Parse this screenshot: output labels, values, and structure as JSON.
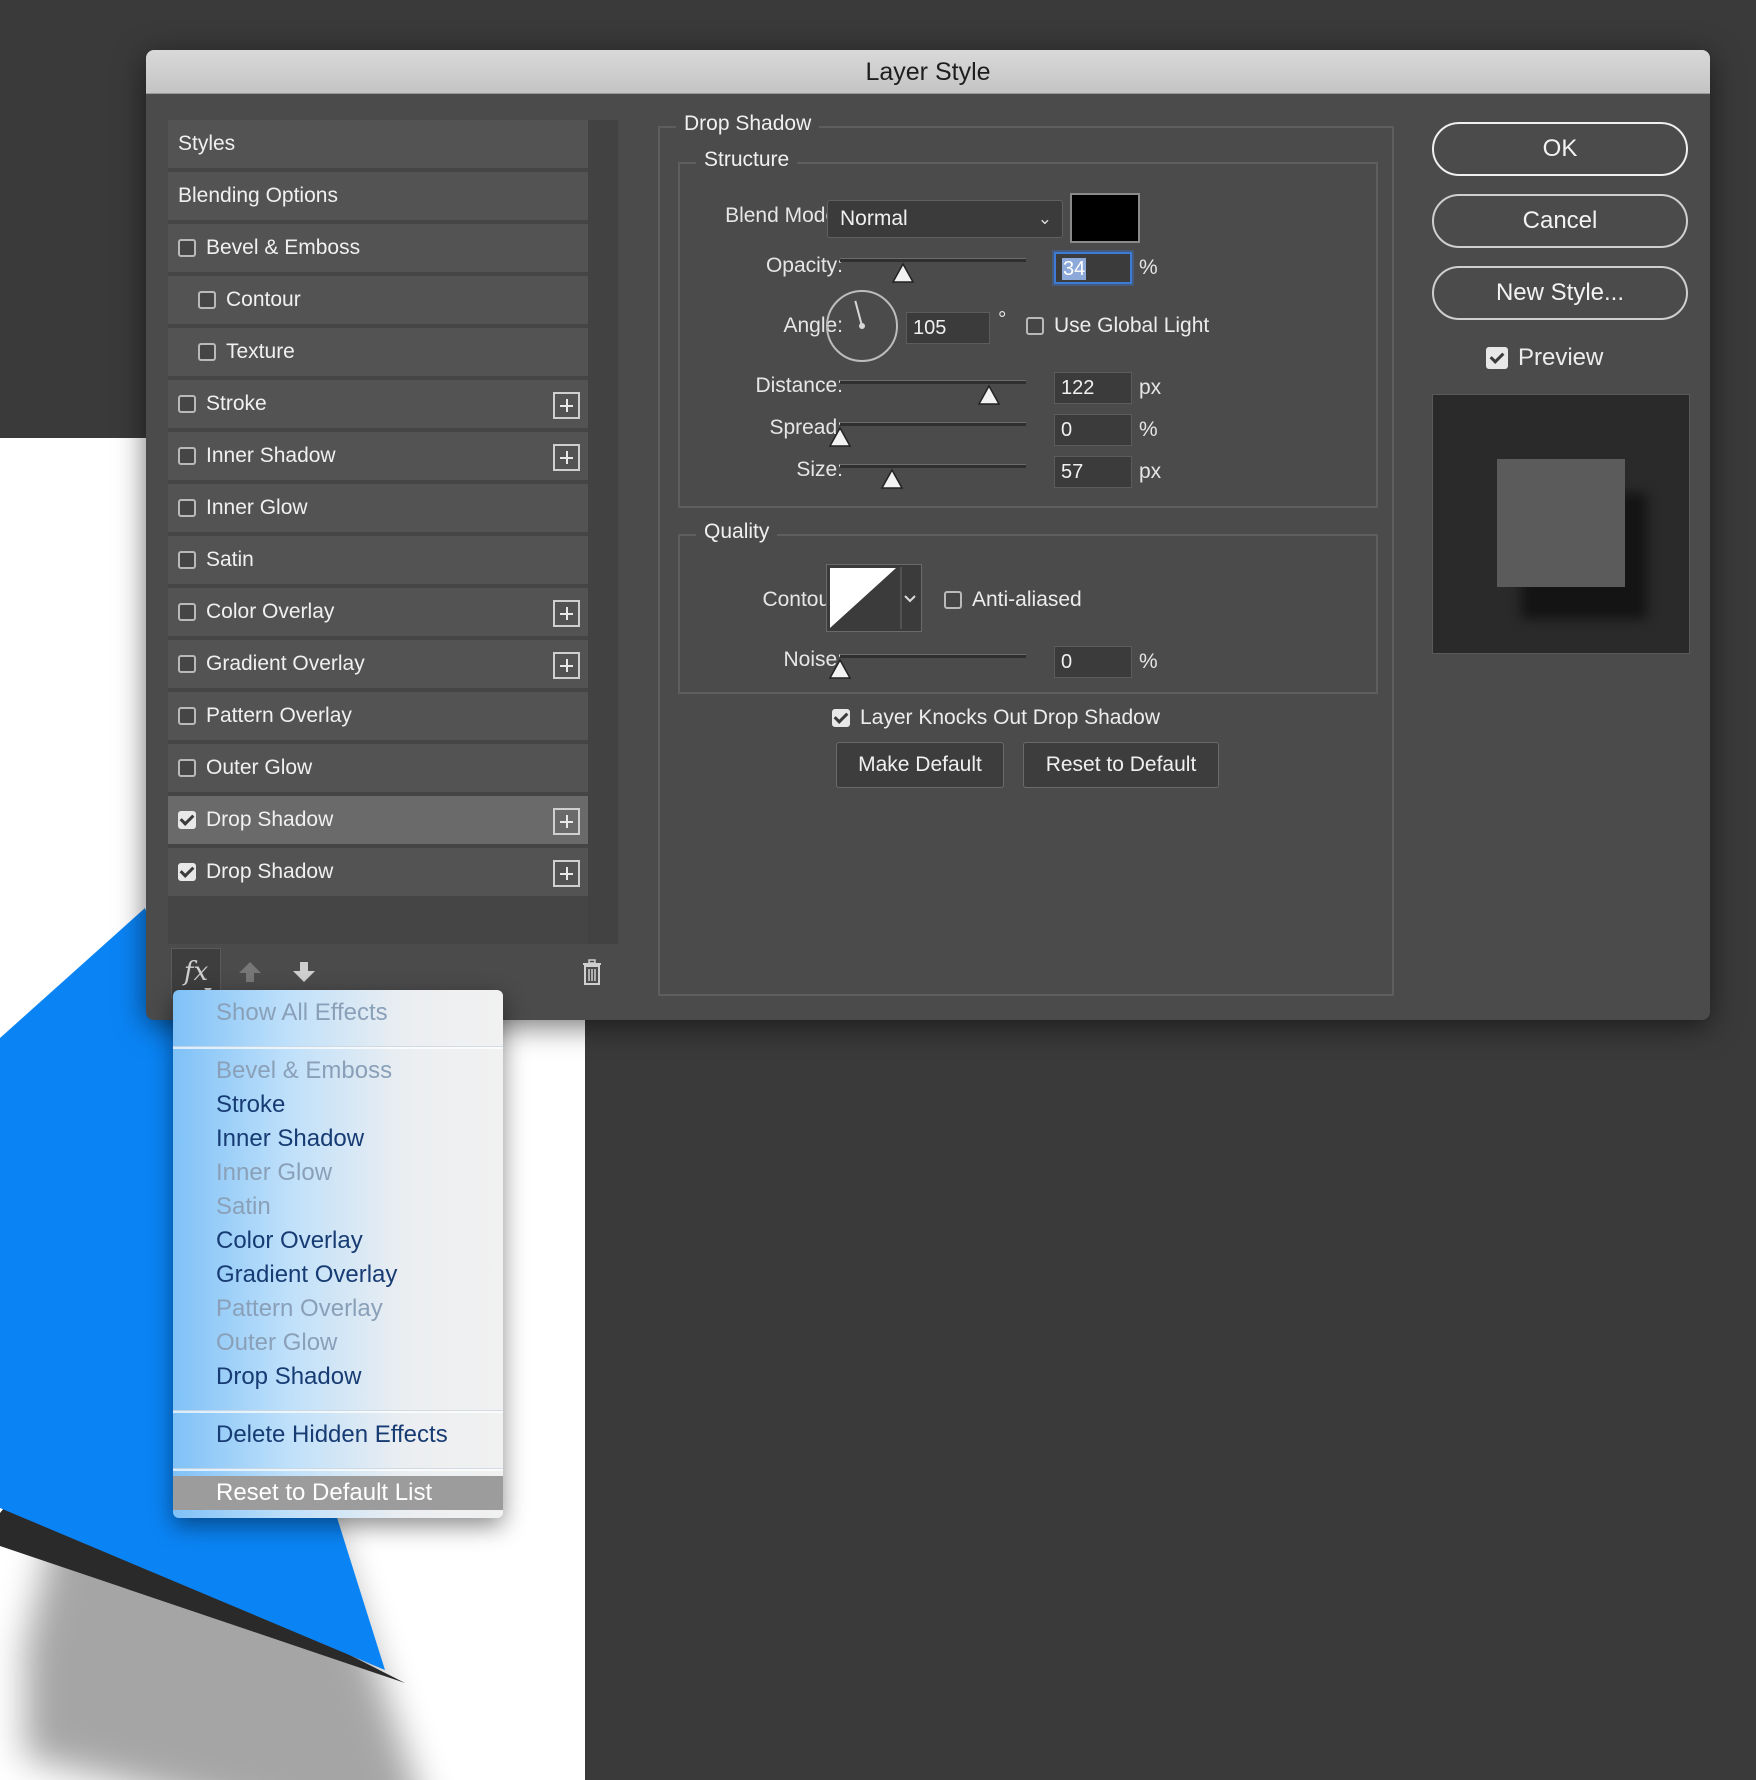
{
  "dialog": {
    "title": "Layer Style"
  },
  "style_list": {
    "items": [
      {
        "label": "Styles",
        "checkbox": false,
        "checked": false,
        "indent": 0,
        "plus": false,
        "selected": false
      },
      {
        "label": "Blending Options",
        "checkbox": false,
        "checked": false,
        "indent": 0,
        "plus": false,
        "selected": false
      },
      {
        "label": "Bevel & Emboss",
        "checkbox": true,
        "checked": false,
        "indent": 0,
        "plus": false,
        "selected": false
      },
      {
        "label": "Contour",
        "checkbox": true,
        "checked": false,
        "indent": 1,
        "plus": false,
        "selected": false
      },
      {
        "label": "Texture",
        "checkbox": true,
        "checked": false,
        "indent": 1,
        "plus": false,
        "selected": false
      },
      {
        "label": "Stroke",
        "checkbox": true,
        "checked": false,
        "indent": 0,
        "plus": true,
        "selected": false
      },
      {
        "label": "Inner Shadow",
        "checkbox": true,
        "checked": false,
        "indent": 0,
        "plus": true,
        "selected": false
      },
      {
        "label": "Inner Glow",
        "checkbox": true,
        "checked": false,
        "indent": 0,
        "plus": false,
        "selected": false
      },
      {
        "label": "Satin",
        "checkbox": true,
        "checked": false,
        "indent": 0,
        "plus": false,
        "selected": false
      },
      {
        "label": "Color Overlay",
        "checkbox": true,
        "checked": false,
        "indent": 0,
        "plus": true,
        "selected": false
      },
      {
        "label": "Gradient Overlay",
        "checkbox": true,
        "checked": false,
        "indent": 0,
        "plus": true,
        "selected": false
      },
      {
        "label": "Pattern Overlay",
        "checkbox": true,
        "checked": false,
        "indent": 0,
        "plus": false,
        "selected": false
      },
      {
        "label": "Outer Glow",
        "checkbox": true,
        "checked": false,
        "indent": 0,
        "plus": false,
        "selected": false
      },
      {
        "label": "Drop Shadow",
        "checkbox": true,
        "checked": true,
        "indent": 0,
        "plus": true,
        "selected": true
      },
      {
        "label": "Drop Shadow",
        "checkbox": true,
        "checked": true,
        "indent": 0,
        "plus": true,
        "selected": false
      }
    ],
    "toolbar": {
      "fx_label": "fx"
    }
  },
  "drop_shadow": {
    "title": "Drop Shadow",
    "structure": {
      "title": "Structure",
      "blend_mode_label": "Blend Mode:",
      "blend_mode_value": "Normal",
      "shadow_color": "#000000",
      "opacity_label": "Opacity:",
      "opacity_value": "34",
      "opacity_fraction": 0.34,
      "opacity_unit": "%",
      "angle_label": "Angle:",
      "angle_value": "105",
      "angle_unit": "°",
      "use_global_light_label": "Use Global Light",
      "use_global_light_checked": false,
      "distance_label": "Distance:",
      "distance_value": "122",
      "distance_fraction": 0.8,
      "distance_unit": "px",
      "spread_label": "Spread:",
      "spread_value": "0",
      "spread_fraction": 0.0,
      "spread_unit": "%",
      "size_label": "Size:",
      "size_value": "57",
      "size_fraction": 0.28,
      "size_unit": "px"
    },
    "quality": {
      "title": "Quality",
      "contour_label": "Contour:",
      "anti_aliased_label": "Anti-aliased",
      "anti_aliased_checked": false,
      "noise_label": "Noise:",
      "noise_value": "0",
      "noise_fraction": 0.0,
      "noise_unit": "%"
    },
    "layer_knocks_out_label": "Layer Knocks Out Drop Shadow",
    "layer_knocks_out_checked": true,
    "make_default_label": "Make Default",
    "reset_default_label": "Reset to Default"
  },
  "actions": {
    "ok_label": "OK",
    "cancel_label": "Cancel",
    "new_style_label": "New Style...",
    "preview_label": "Preview",
    "preview_checked": true
  },
  "fx_menu": {
    "items": [
      {
        "label": "Show All Effects",
        "disabled": true
      },
      {
        "label": "Bevel & Emboss",
        "disabled": true
      },
      {
        "label": "Stroke",
        "disabled": false
      },
      {
        "label": "Inner Shadow",
        "disabled": false
      },
      {
        "label": "Inner Glow",
        "disabled": true
      },
      {
        "label": "Satin",
        "disabled": true
      },
      {
        "label": "Color Overlay",
        "disabled": false
      },
      {
        "label": "Gradient Overlay",
        "disabled": false
      },
      {
        "label": "Pattern Overlay",
        "disabled": true
      },
      {
        "label": "Outer Glow",
        "disabled": true
      },
      {
        "label": "Drop Shadow",
        "disabled": false
      },
      {
        "label": "Delete Hidden Effects",
        "disabled": false
      },
      {
        "label": "Reset to Default List",
        "disabled": false,
        "highlighted": true
      }
    ]
  },
  "colors": {
    "canvas_blue": "#0a84f5",
    "focus_blue": "#3d7bd6"
  }
}
